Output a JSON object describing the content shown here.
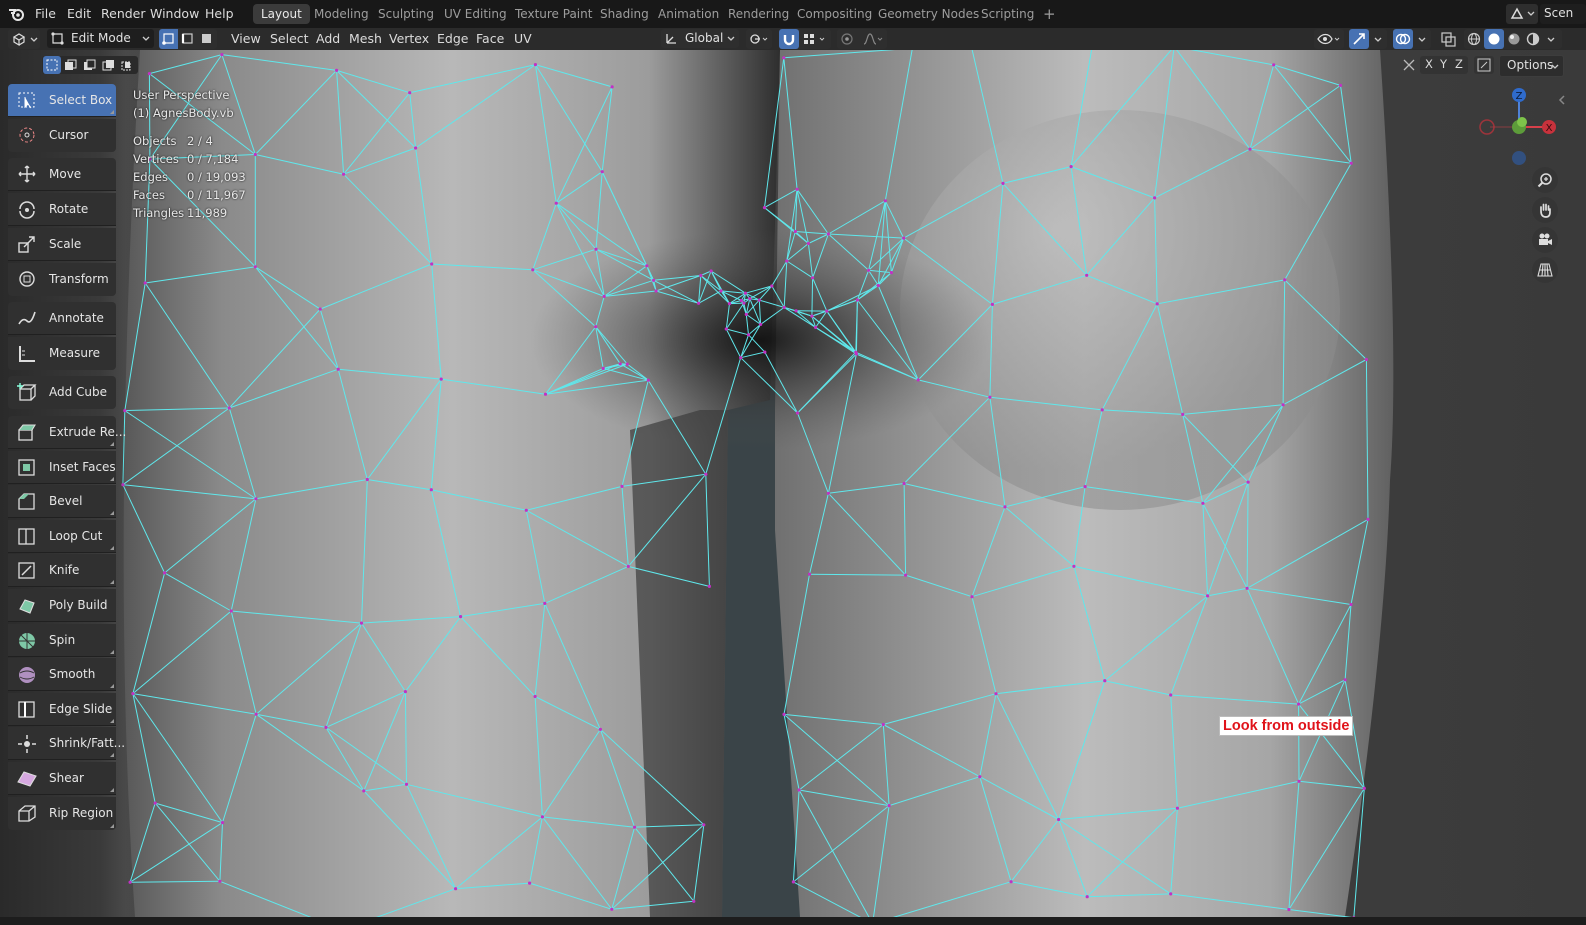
{
  "app": {
    "menu": [
      "File",
      "Edit",
      "Render",
      "Window",
      "Help"
    ],
    "workspaces": [
      "Layout",
      "Modeling",
      "Sculpting",
      "UV Editing",
      "Texture Paint",
      "Shading",
      "Animation",
      "Rendering",
      "Compositing",
      "Geometry Nodes",
      "Scripting"
    ],
    "active_workspace": "Layout",
    "add_tab": "+",
    "scene_label": "Scen"
  },
  "header": {
    "mode": "Edit Mode",
    "menus": [
      "View",
      "Select",
      "Add",
      "Mesh",
      "Vertex",
      "Edge",
      "Face",
      "UV"
    ],
    "orientation": "Global",
    "options": "Options"
  },
  "axes": [
    "X",
    "Y",
    "Z"
  ],
  "viewport_info": {
    "perspective": "User Perspective",
    "object": "(1) AgnesBody.vb",
    "stats": [
      {
        "label": "Objects",
        "value": "2 / 4"
      },
      {
        "label": "Vertices",
        "value": "0 / 7,184"
      },
      {
        "label": "Edges",
        "value": "0 / 19,093"
      },
      {
        "label": "Faces",
        "value": "0 / 11,967"
      },
      {
        "label": "Triangles",
        "value": "11,989"
      }
    ]
  },
  "gizmo": {
    "z": "Z",
    "x": "X"
  },
  "tools": [
    {
      "label": "Select Box",
      "icon": "select-box-icon"
    },
    {
      "label": "Cursor",
      "icon": "cursor-icon"
    },
    {
      "label": "Move",
      "icon": "move-icon"
    },
    {
      "label": "Rotate",
      "icon": "rotate-icon"
    },
    {
      "label": "Scale",
      "icon": "scale-icon"
    },
    {
      "label": "Transform",
      "icon": "transform-icon"
    },
    {
      "label": "Annotate",
      "icon": "annotate-icon"
    },
    {
      "label": "Measure",
      "icon": "measure-icon"
    },
    {
      "label": "Add Cube",
      "icon": "add-cube-icon"
    },
    {
      "label": "Extrude Re...",
      "icon": "extrude-icon"
    },
    {
      "label": "Inset Faces",
      "icon": "inset-faces-icon"
    },
    {
      "label": "Bevel",
      "icon": "bevel-icon"
    },
    {
      "label": "Loop Cut",
      "icon": "loop-cut-icon"
    },
    {
      "label": "Knife",
      "icon": "knife-icon"
    },
    {
      "label": "Poly Build",
      "icon": "poly-build-icon"
    },
    {
      "label": "Spin",
      "icon": "spin-icon"
    },
    {
      "label": "Smooth",
      "icon": "smooth-icon"
    },
    {
      "label": "Edge Slide",
      "icon": "edge-slide-icon"
    },
    {
      "label": "Shrink/Fatt...",
      "icon": "shrink-fatten-icon"
    },
    {
      "label": "Shear",
      "icon": "shear-icon"
    },
    {
      "label": "Rip Region",
      "icon": "rip-region-icon"
    }
  ],
  "annotation": "Look from outside",
  "colors": {
    "wire": "#5fe8ec",
    "vertex": "#c231c4",
    "accent": "#4772b3",
    "annotation": "#e0131a"
  }
}
